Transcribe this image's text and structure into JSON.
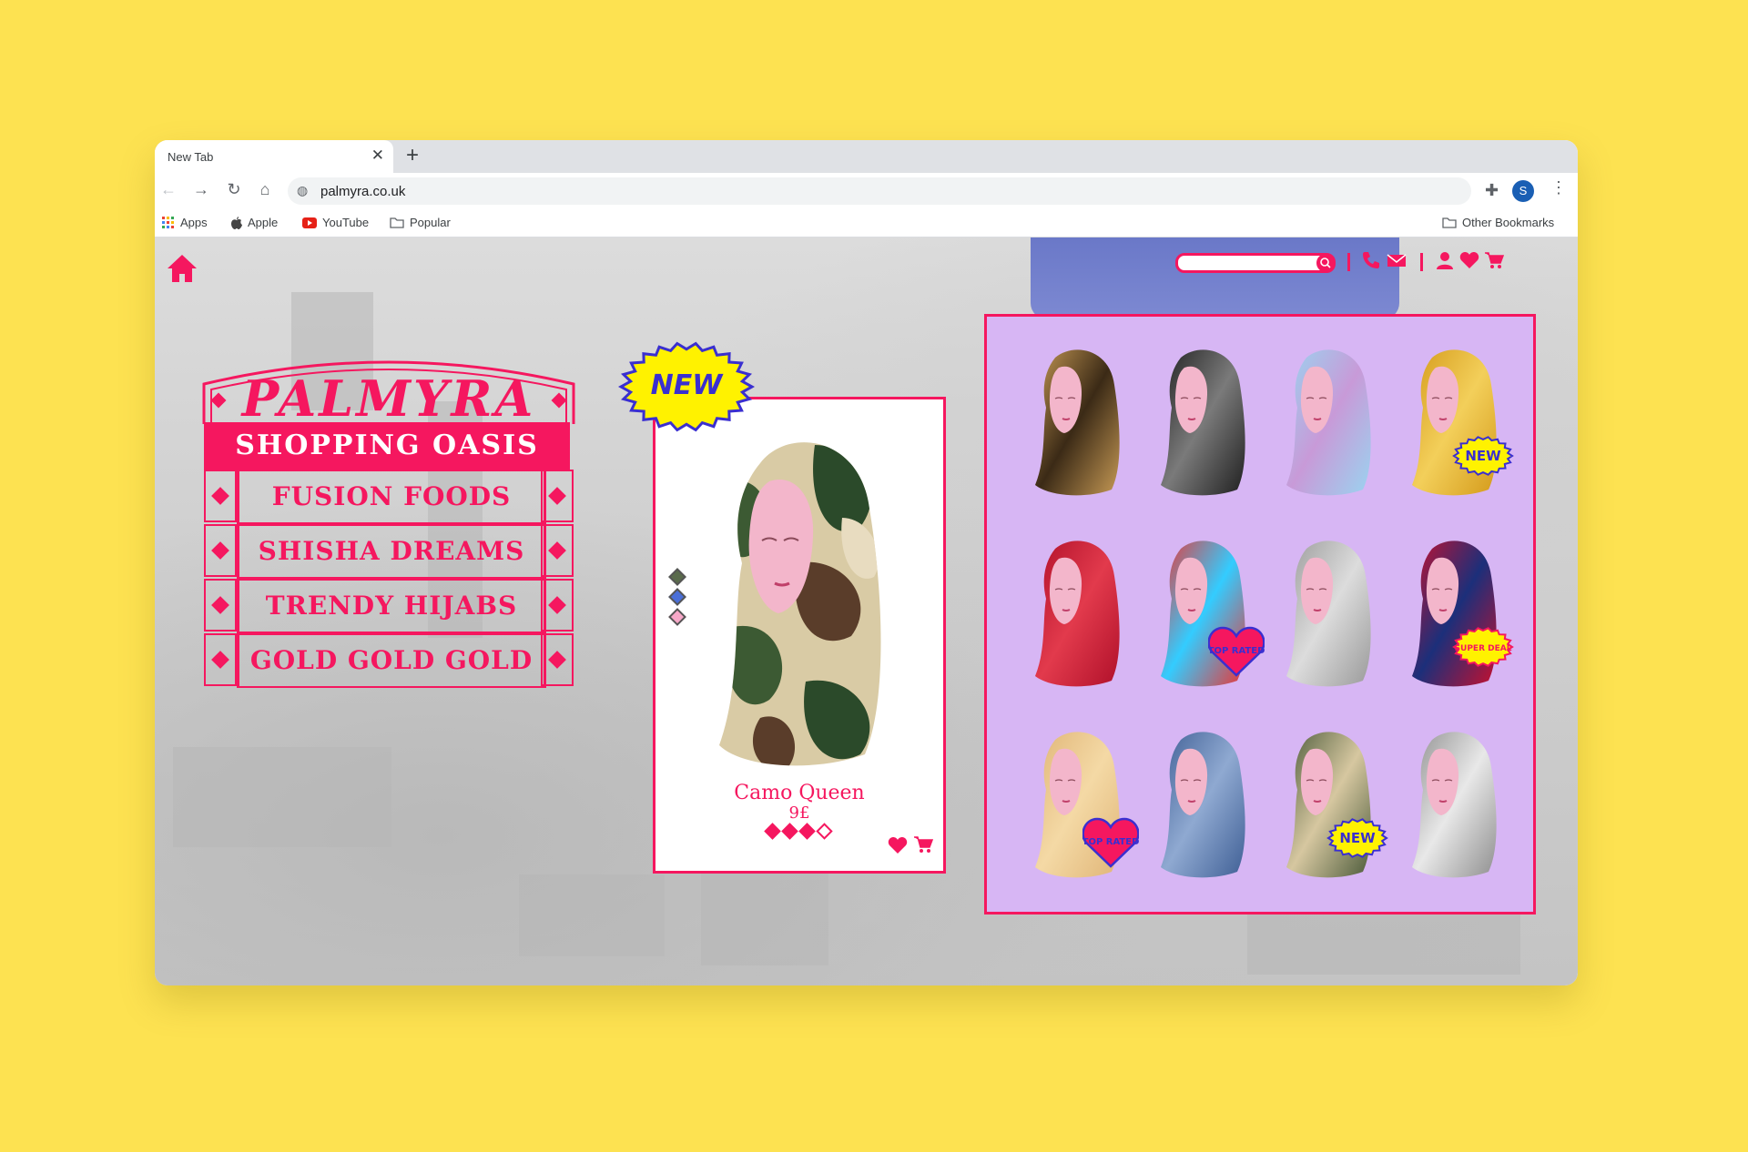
{
  "browser": {
    "tab_title": "New Tab",
    "tab_close": "✕",
    "new_tab": "+",
    "url": "palmyra.co.uk",
    "profile_initial": "S",
    "bookmarks": [
      {
        "label": "Apps",
        "icon": "apps-grid-icon"
      },
      {
        "label": "Apple",
        "icon": "apple-icon"
      },
      {
        "label": "YouTube",
        "icon": "youtube-icon"
      },
      {
        "label": "Popular",
        "icon": "folder-icon"
      }
    ],
    "other_bookmarks": "Other Bookmarks"
  },
  "site": {
    "accent": "#f5175f",
    "brand": "PALMYRA",
    "tagline": "SHOPPING OASIS",
    "menu": [
      {
        "label": "FUSION FOODS"
      },
      {
        "label": "SHISHA DREAMS"
      },
      {
        "label": "TRENDY HIJABS"
      },
      {
        "label": "GOLD GOLD GOLD"
      }
    ],
    "header_icons": [
      "search-icon",
      "phone-icon",
      "mail-icon",
      "user-icon",
      "heart-icon",
      "cart-icon"
    ]
  },
  "featured": {
    "badge": "NEW",
    "name": "Camo Queen",
    "price": "9£",
    "rating": 3,
    "rating_max": 4,
    "swatches": [
      "#5a6b4c",
      "#4a6fd8",
      "#f7a8c8"
    ]
  },
  "grid": {
    "products": [
      {
        "pattern": "leopard",
        "colors": [
          "#c79a55",
          "#3b2a16"
        ],
        "badge": ""
      },
      {
        "pattern": "black-silk",
        "colors": [
          "#1f1f1f",
          "#7a7a7a"
        ],
        "badge": ""
      },
      {
        "pattern": "holographic",
        "colors": [
          "#9ad4f0",
          "#c89ad8"
        ],
        "badge": ""
      },
      {
        "pattern": "gold",
        "colors": [
          "#d49a1a",
          "#f3cf5a"
        ],
        "badge": "NEW"
      },
      {
        "pattern": "red-velvet",
        "colors": [
          "#b0102a",
          "#e23a4c"
        ],
        "badge": ""
      },
      {
        "pattern": "tie-dye",
        "colors": [
          "#e33",
          "#3cf"
        ],
        "badge": "TOP RATED"
      },
      {
        "pattern": "silver-mesh",
        "colors": [
          "#9a9a9a",
          "#dcdcdc"
        ],
        "badge": ""
      },
      {
        "pattern": "stars-stripes",
        "colors": [
          "#c8102e",
          "#1c2f7a"
        ],
        "badge": "SUPER DEAL"
      },
      {
        "pattern": "fur",
        "colors": [
          "#e0b577",
          "#f4d9a5"
        ],
        "badge": "TOP RATED"
      },
      {
        "pattern": "denim",
        "colors": [
          "#3f5f95",
          "#8fa9d1"
        ],
        "badge": ""
      },
      {
        "pattern": "camo",
        "colors": [
          "#4b5a3a",
          "#d6c7a0"
        ],
        "badge": "NEW"
      },
      {
        "pattern": "sequins",
        "colors": [
          "#8f8f8f",
          "#e8e8e8"
        ],
        "badge": ""
      }
    ]
  }
}
